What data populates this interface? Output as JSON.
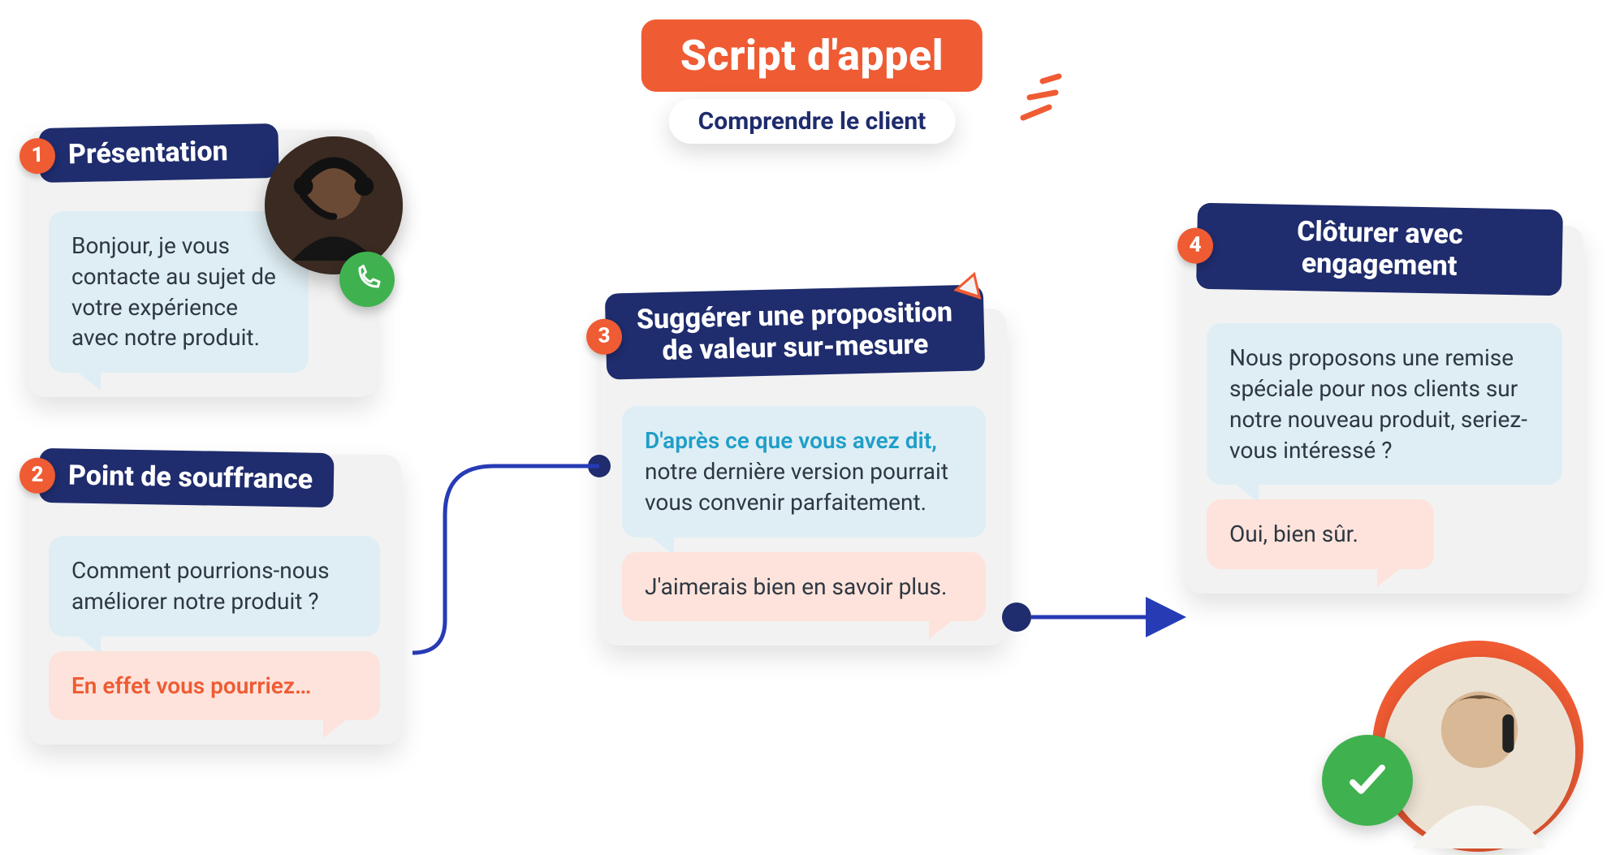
{
  "header": {
    "title": "Script d'appel",
    "subtitle": "Comprendre le client"
  },
  "steps": [
    {
      "num": "1",
      "title": "Présentation",
      "bubbles": [
        {
          "type": "blue",
          "text": "Bonjour, je vous contacte au sujet de votre expérience avec notre produit."
        }
      ]
    },
    {
      "num": "2",
      "title": "Point de souffrance",
      "bubbles": [
        {
          "type": "blue",
          "text": "Comment pourrions-nous améliorer notre produit ?"
        },
        {
          "type": "peach",
          "highlight": "En effet vous pourriez…"
        }
      ]
    },
    {
      "num": "3",
      "title": "Suggérer une proposition de valeur sur-mesure",
      "bubbles": [
        {
          "type": "blue",
          "highlight": "D'après ce que vous avez dit,",
          "text": " notre dernière version pourrait vous convenir parfaitement."
        },
        {
          "type": "peach",
          "text": "J'aimerais bien en savoir plus."
        }
      ]
    },
    {
      "num": "4",
      "title": "Clôturer avec engagement",
      "bubbles": [
        {
          "type": "blue",
          "text": "Nous proposons une remise spéciale pour nos clients sur notre nouveau produit, seriez-vous intéressé ?"
        },
        {
          "type": "peach",
          "text": "Oui, bien sûr."
        }
      ]
    }
  ],
  "icons": {
    "agent": "agent-avatar",
    "client": "client-avatar",
    "phone": "phone-icon",
    "check": "check-icon"
  },
  "colors": {
    "orange": "#ef5b33",
    "navy": "#1f2c6d",
    "blueInk": "#273bb5",
    "green": "#3fb24f",
    "bubbleBlue": "#dfeef4",
    "bubblePeach": "#fde3db"
  }
}
